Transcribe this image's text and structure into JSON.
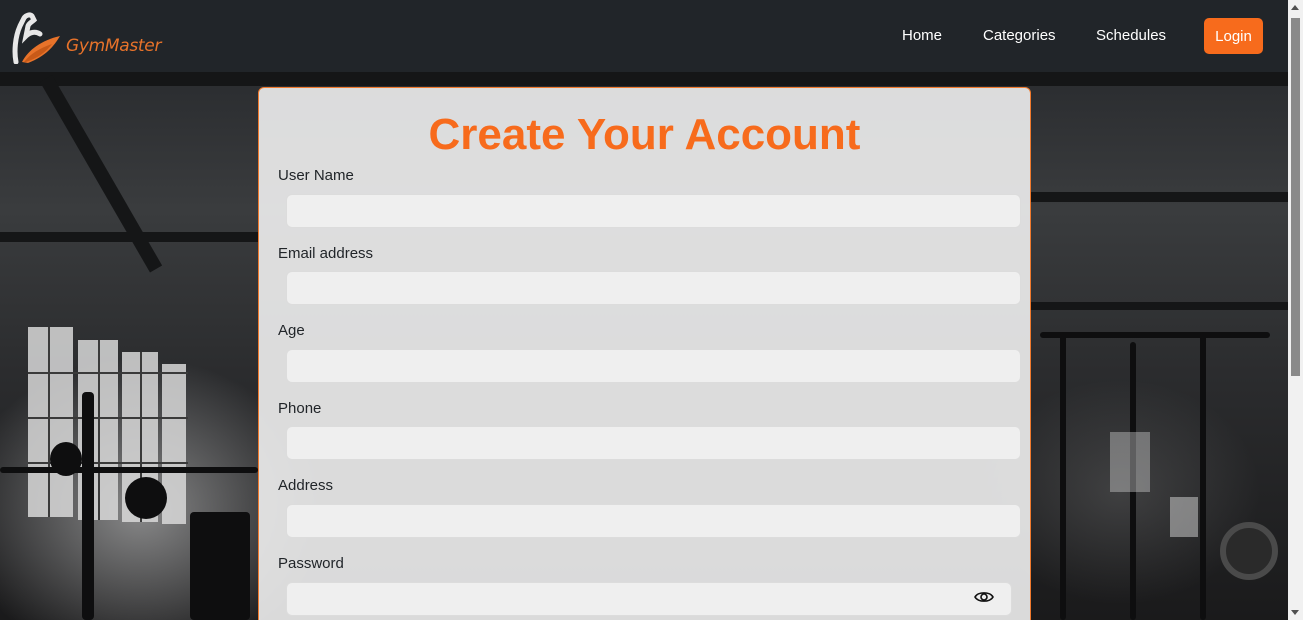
{
  "brand": {
    "name": "GymMaster"
  },
  "nav": {
    "links": [
      "Home",
      "Categories",
      "Schedules"
    ],
    "login_label": "Login"
  },
  "form": {
    "title": "Create Your Account",
    "fields": [
      {
        "label": "User Name",
        "value": ""
      },
      {
        "label": "Email address",
        "value": ""
      },
      {
        "label": "Age",
        "value": ""
      },
      {
        "label": "Phone",
        "value": ""
      },
      {
        "label": "Address",
        "value": ""
      },
      {
        "label": "Password",
        "value": ""
      }
    ],
    "password_toggle_icon": "eye-icon"
  },
  "colors": {
    "accent": "#f76b1c",
    "navbar": "#212529"
  }
}
